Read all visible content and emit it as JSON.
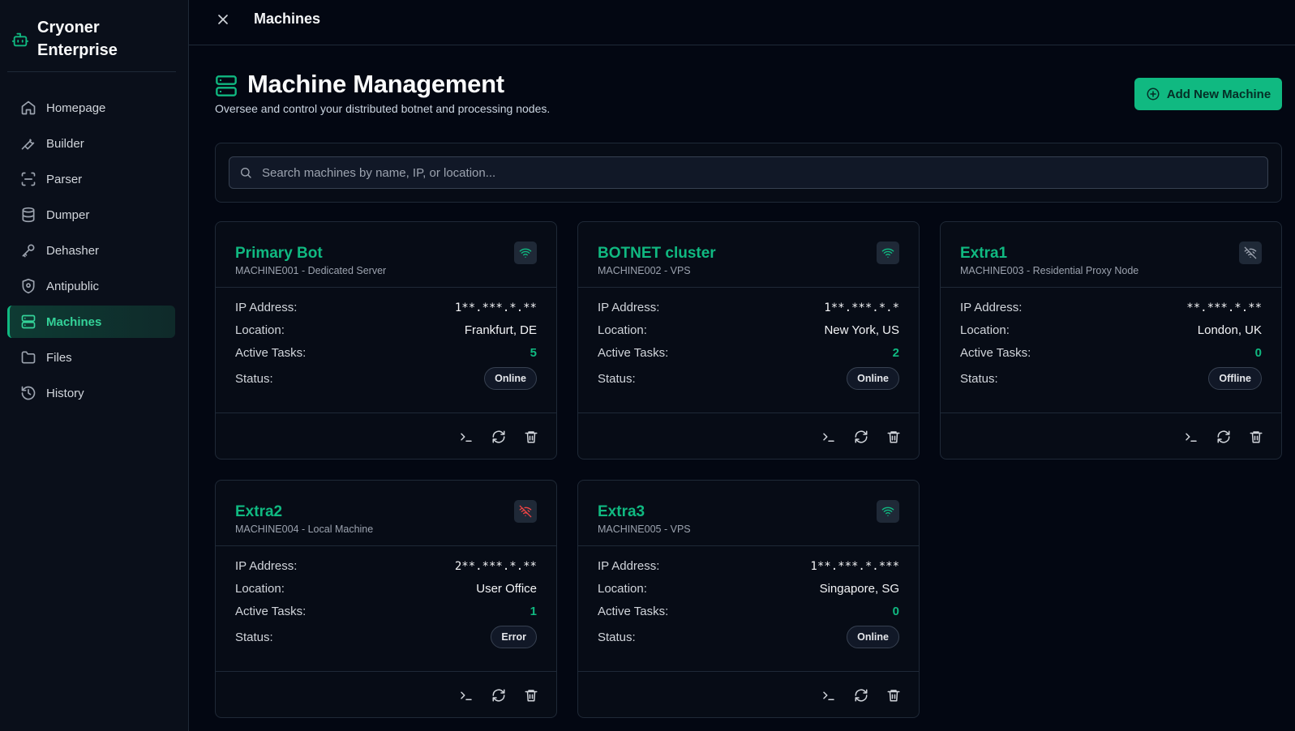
{
  "sidebar": {
    "brand": "Cryoner Enterprise",
    "items": [
      {
        "label": "Homepage",
        "icon": "home-icon"
      },
      {
        "label": "Builder",
        "icon": "wrench-icon"
      },
      {
        "label": "Parser",
        "icon": "scan-icon"
      },
      {
        "label": "Dumper",
        "icon": "database-icon"
      },
      {
        "label": "Dehasher",
        "icon": "key-icon"
      },
      {
        "label": "Antipublic",
        "icon": "shield-icon"
      },
      {
        "label": "Machines",
        "icon": "server-icon",
        "active": true
      },
      {
        "label": "Files",
        "icon": "folder-icon"
      },
      {
        "label": "History",
        "icon": "history-icon"
      }
    ]
  },
  "topbar": {
    "title": "Machines"
  },
  "header": {
    "title": "Machine Management",
    "subtitle": "Oversee and control your distributed botnet and processing nodes.",
    "add_button": "Add New Machine"
  },
  "search": {
    "placeholder": "Search machines by name, IP, or location..."
  },
  "labels": {
    "ip": "IP Address:",
    "location": "Location:",
    "tasks": "Active Tasks:",
    "status": "Status:"
  },
  "machines": [
    {
      "name": "Primary Bot",
      "meta": "MACHINE001 - Dedicated Server",
      "ip": "1**.***.*.**",
      "location": "Frankfurt, DE",
      "tasks": "5",
      "status": "Online",
      "connection": "wifi"
    },
    {
      "name": "BOTNET cluster",
      "meta": "MACHINE002 - VPS",
      "ip": "1**.***.*.*",
      "location": "New York, US",
      "tasks": "2",
      "status": "Online",
      "connection": "wifi"
    },
    {
      "name": "Extra1",
      "meta": "MACHINE003 - Residential Proxy Node",
      "ip": "**.***.*.**",
      "location": "London, UK",
      "tasks": "0",
      "status": "Offline",
      "connection": "wifi-off"
    },
    {
      "name": "Extra2",
      "meta": "MACHINE004 - Local Machine",
      "ip": "2**.***.*.**",
      "location": "User Office",
      "tasks": "1",
      "status": "Error",
      "connection": "wifi-error"
    },
    {
      "name": "Extra3",
      "meta": "MACHINE005 - VPS",
      "ip": "1**.***.*.***",
      "location": "Singapore, SG",
      "tasks": "0",
      "status": "Online",
      "connection": "wifi"
    }
  ],
  "colors": {
    "accent": "#10b981",
    "error": "#ef4444",
    "background": "#030712"
  }
}
